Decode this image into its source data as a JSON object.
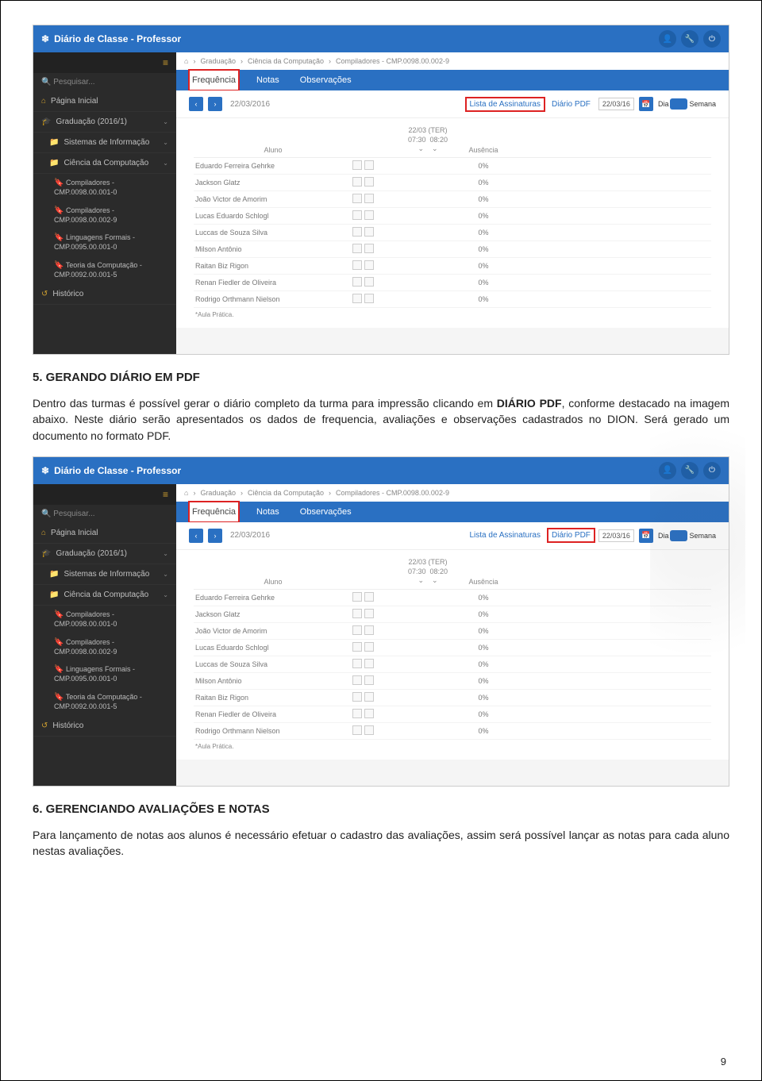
{
  "app": {
    "title": "Diário de Classe - Professor",
    "icons": {
      "logo": "❄",
      "user": "👤",
      "wrench": "🔧",
      "power": "⏻"
    }
  },
  "sidebar": {
    "hamburger": "≡",
    "search_placeholder": "Pesquisar...",
    "home": "Página Inicial",
    "graduacao": "Graduação (2016/1)",
    "sistemas": "Sistemas de Informação",
    "ciencia": "Ciência da Computação",
    "subs": [
      "Compiladores - CMP.0098.00.001-0",
      "Compiladores - CMP.0098.00.002-9",
      "Linguagens Formais - CMP.0095.00.001-0",
      "Teoria da Computação - CMP.0092.00.001-5"
    ],
    "historico": "Histórico"
  },
  "breadcrumbs": [
    "⌂",
    "Graduação",
    "Ciência da Computação",
    "Compiladores - CMP.0098.00.002-9"
  ],
  "tabs": [
    "Frequência",
    "Notas",
    "Observações"
  ],
  "toolbar": {
    "date": "22/03/2016",
    "lista": "Lista de Assinaturas",
    "diario": "Diário PDF",
    "short_date": "22/03/16",
    "dia": "Dia",
    "semana": "Semana"
  },
  "table": {
    "col_aluno": "Aluno",
    "col_date_top": "22/03 (TER)",
    "col_time1": "07:30",
    "col_time2": "08:20",
    "col_ausencia": "Ausência",
    "rows": [
      {
        "name": "Eduardo Ferreira Gehrke",
        "aus": "0%"
      },
      {
        "name": "Jackson Glatz",
        "aus": "0%"
      },
      {
        "name": "João Victor de Amorim",
        "aus": "0%"
      },
      {
        "name": "Lucas Eduardo Schlogl",
        "aus": "0%"
      },
      {
        "name": "Luccas de Souza Silva",
        "aus": "0%"
      },
      {
        "name": "Milson Antônio",
        "aus": "0%"
      },
      {
        "name": "Raitan Biz Rigon",
        "aus": "0%"
      },
      {
        "name": "Renan Fiedler de Oliveira",
        "aus": "0%"
      },
      {
        "name": "Rodrigo Orthmann Nielson",
        "aus": "0%"
      }
    ],
    "footnote": "*Aula Prática."
  },
  "doc": {
    "h5": "5. GERANDO DIÁRIO EM PDF",
    "p5a": "Dentro das turmas é possível gerar o diário completo da turma para impressão clicando em ",
    "p5b": "DIÁRIO PDF",
    "p5c": ", conforme destacado na imagem abaixo. Neste diário serão apresentados os dados de frequencia, avaliações e observações cadastrados no DION. Será gerado um documento no formato PDF.",
    "h6": "6. GERENCIANDO AVALIAÇÕES E NOTAS",
    "p6": "Para lançamento de notas aos alunos é necessário efetuar o cadastro das avaliações, assim será possível lançar as notas para cada aluno nestas avaliações.",
    "pagenum": "9"
  },
  "highlight": {
    "first": "lista",
    "second": "diario"
  }
}
